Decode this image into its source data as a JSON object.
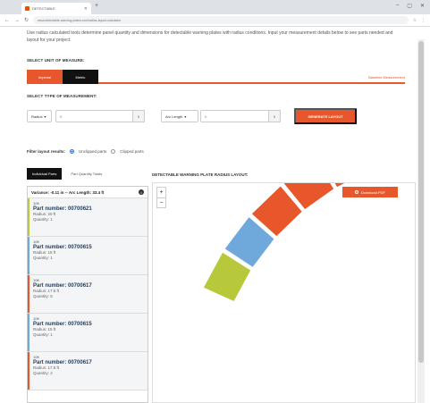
{
  "browser": {
    "tab_title": "DETECTABLE",
    "url": "www.detectable-warning-plates.com/radius-layout-calculator",
    "new_tab": "+",
    "controls": [
      "–",
      "▢",
      "✕"
    ]
  },
  "page": {
    "intro": "Use radius calculated tools determine panel quantity and dimensions for detectable warning plates with radius conditions. Input your measurement details below to see parts needed and layout for your project.",
    "unit_section_label": "SELECT UNIT OF MEASURE:",
    "units": [
      "Imperial",
      "Metric"
    ],
    "baseline_link": "Baseline Measurement",
    "measurement_label": "SELECT TYPE OF MEASUREMENT:",
    "measure_type": "Radius",
    "radius_value": "ft.",
    "radius_unit": "ft",
    "arc_type": "Arc Length",
    "arc_value": "ft.",
    "arc_unit": "ft",
    "generate_button": "GENERATE LAYOUT",
    "filter_label": "Filter layout results:",
    "filter_options": [
      "Unclipped parts",
      "Clipped parts"
    ],
    "tabs": [
      "Individual Parts",
      "Part Quantity Totals"
    ],
    "layout_title": "DETECTABLE WARNING PLATE RADIUS LAYOUT:",
    "download_button": "Download PDF",
    "zoom_in": "+",
    "zoom_out": "−"
  },
  "parts_panel": {
    "variance": "Variance: -0.11 in -- Arc Length: 33.4 ft",
    "info_icon": "i",
    "items": [
      {
        "deg": "10ft",
        "part_number": "Part number: 00700621",
        "radius": "Radius: 20 ft",
        "quantity": "Quantity: 1",
        "color": "#b7c93a"
      },
      {
        "deg": "10ft",
        "part_number": "Part number: 00700615",
        "radius": "Radius: 15 ft",
        "quantity": "Quantity: 1",
        "color": "#6fa9dc"
      },
      {
        "deg": "10ft",
        "part_number": "Part number: 00700617",
        "radius": "Radius: 17.5 ft",
        "quantity": "Quantity: 5",
        "color": "#e8572b"
      },
      {
        "deg": "10ft",
        "part_number": "Part number: 00700615",
        "radius": "Radius: 15 ft",
        "quantity": "Quantity: 1",
        "color": "#6fa9dc"
      },
      {
        "deg": "10ft",
        "part_number": "Part number: 00700617",
        "radius": "Radius: 17.5 ft",
        "quantity": "Quantity: 2",
        "color": "#e8572b"
      }
    ]
  },
  "layout_segments": [
    "#b7c93a",
    "#6fa9dc",
    "#e8572b",
    "#e8572b",
    "#e8572b",
    "#e8572b",
    "#e8572b",
    "#6fa9dc",
    "#e8572b",
    "#e8572b"
  ],
  "colors": {
    "accent": "#e8572b",
    "dark": "#111111",
    "green": "#b7c93a",
    "blue": "#6fa9dc"
  }
}
